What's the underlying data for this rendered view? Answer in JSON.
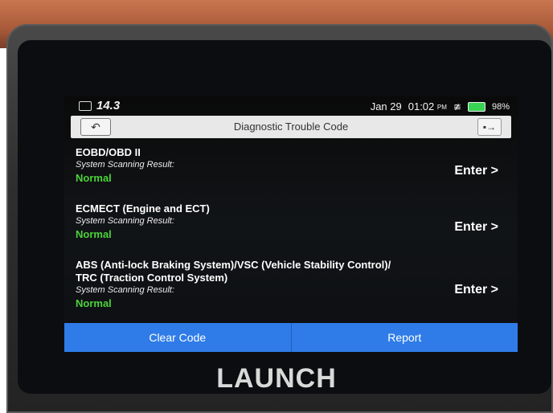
{
  "status_bar": {
    "voltage": "14.3",
    "date": "Jan 29",
    "time": "01:02",
    "ampm": "PM",
    "battery": "98%"
  },
  "title_bar": {
    "title": "Diagnostic Trouble Code"
  },
  "systems": [
    {
      "name": "EOBD/OBD II",
      "result_label": "System Scanning Result:",
      "result": "Normal",
      "enter_label": "Enter >"
    },
    {
      "name": "ECMECT (Engine and ECT)",
      "result_label": "System Scanning Result:",
      "result": "Normal",
      "enter_label": "Enter >"
    },
    {
      "name_line1": "ABS (Anti-lock Braking System)/VSC (Vehicle Stability Control)/",
      "name_line2": "TRC (Traction Control System)",
      "result_label": "System Scanning Result:",
      "result": "Normal",
      "enter_label": "Enter >"
    }
  ],
  "actions": {
    "clear_code": "Clear Code",
    "report": "Report"
  },
  "device": {
    "brand": "LAUNCH"
  },
  "colors": {
    "accent_blue": "#2f7ce8",
    "status_green": "#4cd23a",
    "battery_green": "#39d353"
  },
  "icons": {
    "back": "back-arrow-icon",
    "exit": "exit-icon",
    "wifi": "wifi-icon",
    "battery": "battery-icon",
    "voltage": "battery-voltage-icon"
  }
}
